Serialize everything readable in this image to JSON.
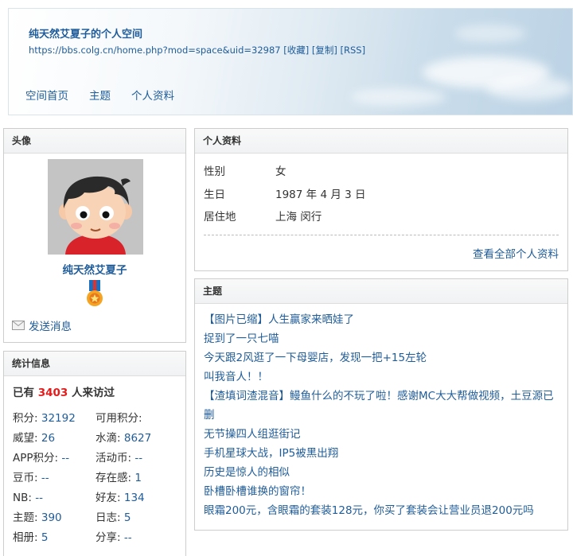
{
  "header": {
    "title": "纯天然艾夏子的个人空间",
    "url": "https://bbs.colg.cn/home.php?mod=space&uid=32987",
    "url_links": [
      "[收藏]",
      "[复制]",
      "[RSS]"
    ],
    "nav": [
      "空间首页",
      "主题",
      "个人资料"
    ]
  },
  "avatar_panel": {
    "heading": "头像",
    "username": "纯天然艾夏子",
    "send_message": "发送消息"
  },
  "stats_panel": {
    "heading": "统计信息",
    "visit_prefix": "已有",
    "visit_count": "3403",
    "visit_suffix": "人来访过",
    "items": [
      {
        "label": "积分:",
        "value": "32192"
      },
      {
        "label": "可用积分:",
        "value": ""
      },
      {
        "label": "威望:",
        "value": "26"
      },
      {
        "label": "水滴:",
        "value": "8627"
      },
      {
        "label": "APP积分:",
        "value": "--"
      },
      {
        "label": "活动币:",
        "value": "--"
      },
      {
        "label": "豆币:",
        "value": "--"
      },
      {
        "label": "存在感:",
        "value": "1"
      },
      {
        "label": "NB:",
        "value": "--"
      },
      {
        "label": "好友:",
        "value": "134"
      },
      {
        "label": "主题:",
        "value": "390"
      },
      {
        "label": "日志:",
        "value": "5"
      },
      {
        "label": "相册:",
        "value": "5"
      },
      {
        "label": "分享:",
        "value": "--"
      }
    ]
  },
  "profile_panel": {
    "heading": "个人资料",
    "rows": [
      {
        "key": "性别",
        "value": "女"
      },
      {
        "key": "生日",
        "value": "1987 年 4 月 3 日"
      },
      {
        "key": "居住地",
        "value": "上海 闵行"
      }
    ],
    "view_all": "查看全部个人资料"
  },
  "topics_panel": {
    "heading": "主题",
    "items": [
      "【图片已缩】人生赢家来晒娃了",
      "捉到了一只七喵",
      "今天跟2风逛了一下母婴店，发现一把+15左轮",
      "叫我音人！！",
      "【渣填词渣混音】鳗鱼什么的不玩了啦！感谢MC大大帮做视频，土豆源已删",
      "无节操四人组逛街记",
      "手机星球大战，IP5被黑出翔",
      "历史是惊人的相似",
      "卧槽卧槽谁换的窗帘！",
      "眼霜200元，含眼霜的套装128元，你买了套装会让营业员退200元吗"
    ]
  },
  "colors": {
    "link": "#1f5c99",
    "highlight": "#e31c1c"
  }
}
